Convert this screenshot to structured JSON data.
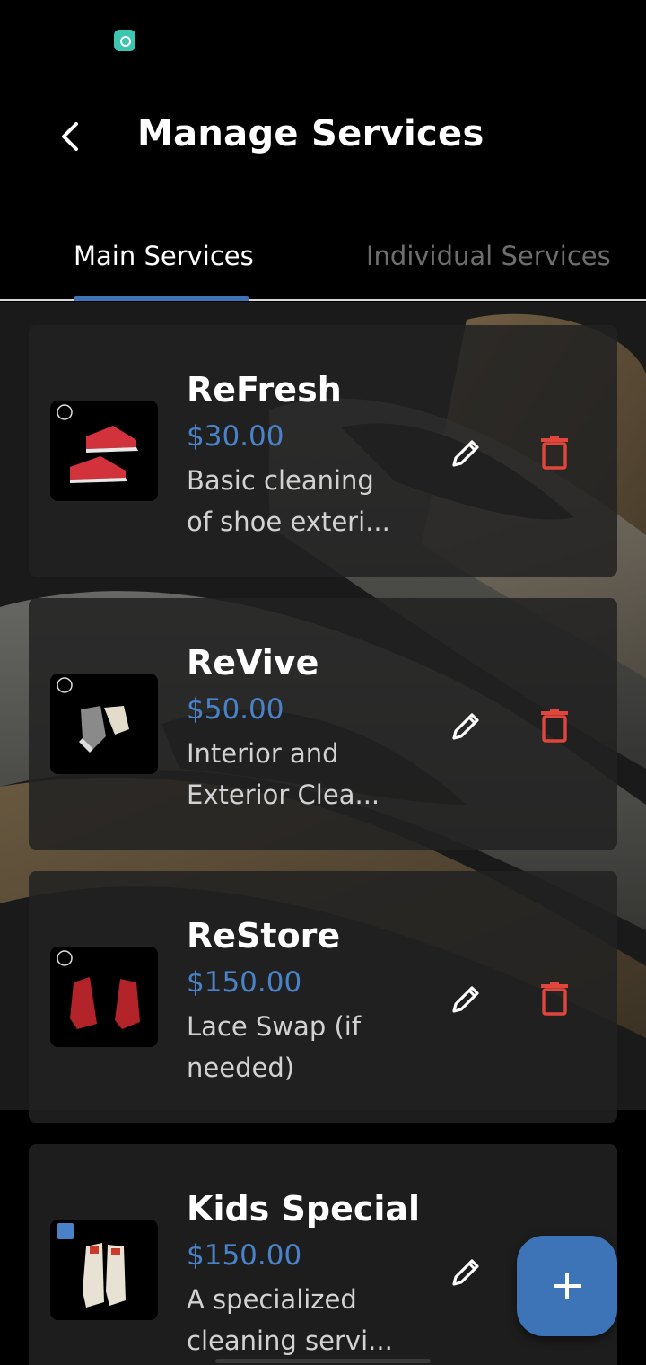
{
  "header": {
    "title": "Manage Services"
  },
  "tabs": [
    {
      "label": "Main Services",
      "active": true
    },
    {
      "label": "Individual Services",
      "active": false
    }
  ],
  "services": [
    {
      "name": "ReFresh",
      "price": "$30.00",
      "description": "Basic cleaning of shoe exteri..."
    },
    {
      "name": "ReVive",
      "price": "$50.00",
      "description": "Interior and Exterior Clea..."
    },
    {
      "name": "ReStore",
      "price": "$150.00",
      "description": "Lace Swap (if needed)"
    },
    {
      "name": "Kids Special",
      "price": "$150.00",
      "description": "A specialized cleaning servi..."
    }
  ],
  "icons": {
    "back": "chevron-left-icon",
    "edit": "pencil-icon",
    "delete": "trash-icon",
    "add": "plus-icon"
  },
  "colors": {
    "accent": "#3d74b8",
    "price": "#4a82c8",
    "delete": "#e0463c",
    "inactive_tab": "#6e6e6e"
  }
}
